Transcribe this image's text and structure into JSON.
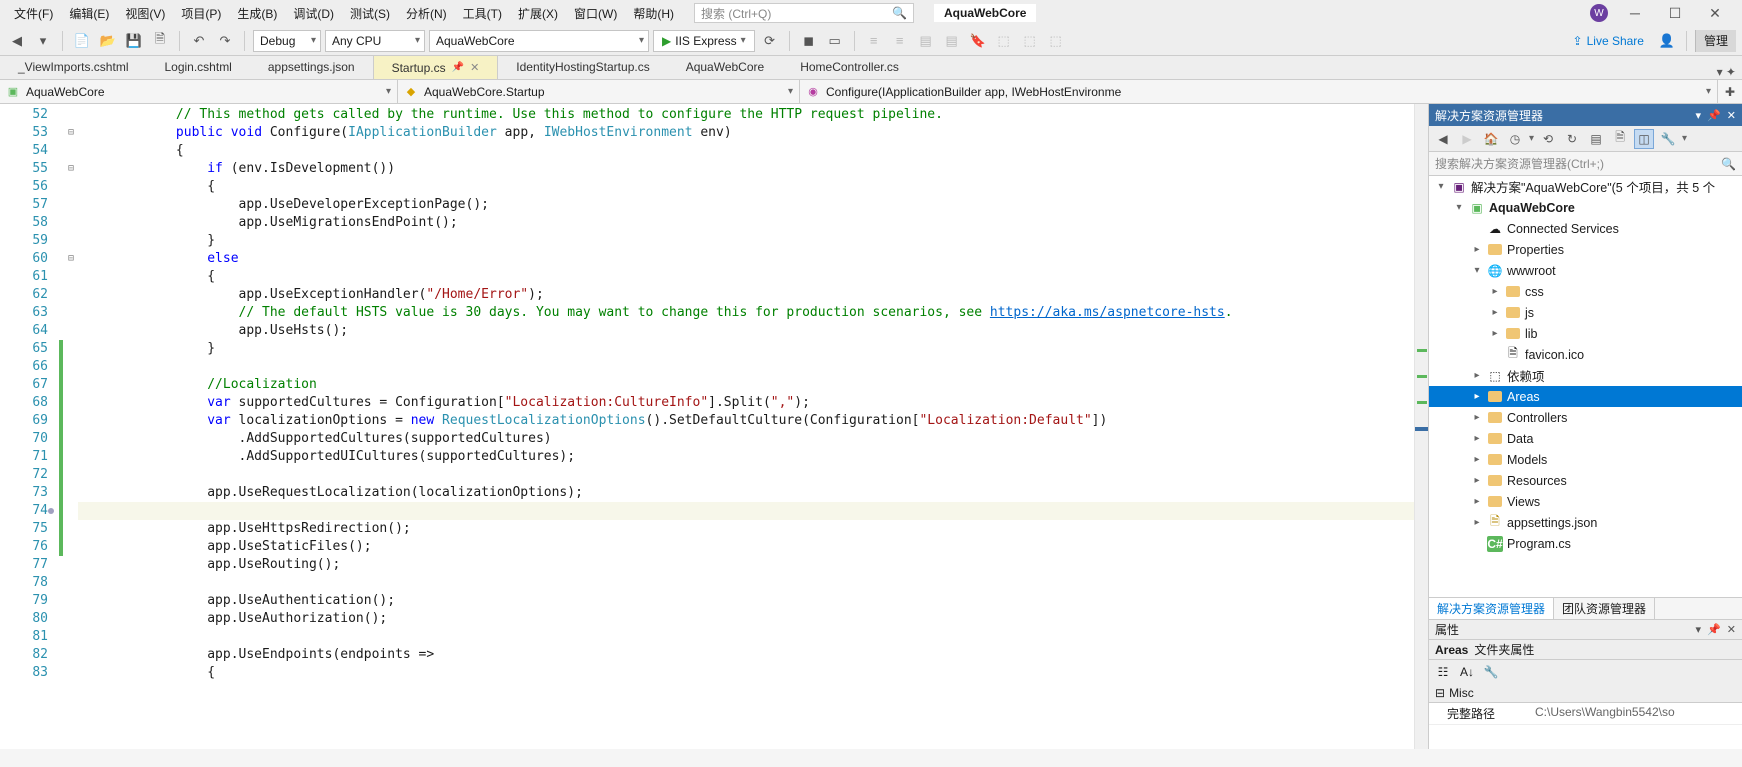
{
  "menu": {
    "items": [
      "文件(F)",
      "编辑(E)",
      "视图(V)",
      "项目(P)",
      "生成(B)",
      "调试(D)",
      "测试(S)",
      "分析(N)",
      "工具(T)",
      "扩展(X)",
      "窗口(W)",
      "帮助(H)"
    ],
    "search_ph": "搜索 (Ctrl+Q)",
    "appname": "AquaWebCore",
    "avatar": "W"
  },
  "toolbar": {
    "config": "Debug",
    "platform": "Any CPU",
    "startup": "AquaWebCore",
    "run": "IIS Express",
    "liveshare": "Live Share",
    "manage": "管理"
  },
  "tabs": {
    "items": [
      {
        "label": "_ViewImports.cshtml",
        "active": false
      },
      {
        "label": "Login.cshtml",
        "active": false
      },
      {
        "label": "appsettings.json",
        "active": false
      },
      {
        "label": "Startup.cs",
        "active": true
      },
      {
        "label": "IdentityHostingStartup.cs",
        "active": false
      },
      {
        "label": "AquaWebCore",
        "active": false
      },
      {
        "label": "HomeController.cs",
        "active": false
      }
    ]
  },
  "nav": {
    "scope": "AquaWebCore",
    "type": "AquaWebCore.Startup",
    "member": "Configure(IApplicationBuilder app, IWebHostEnvironme"
  },
  "code": {
    "first_line": 52,
    "lines": [
      {
        "n": 52,
        "t": "            // This method gets called by the runtime. Use this method to configure the HTTP request pipeline.",
        "cls": "com"
      },
      {
        "n": 53,
        "t": "            public void Configure(IApplicationBuilder app, IWebHostEnvironment env)",
        "parts": [
          [
            "            ",
            ""
          ],
          [
            "public void ",
            "kw"
          ],
          [
            "Configure(",
            ""
          ],
          [
            "IApplicationBuilder",
            "type"
          ],
          [
            " app, ",
            ""
          ],
          [
            "IWebHostEnvironment",
            "type"
          ],
          [
            " env)",
            ""
          ]
        ]
      },
      {
        "n": 54,
        "t": "            {"
      },
      {
        "n": 55,
        "t": "                if (env.IsDevelopment())",
        "parts": [
          [
            "                ",
            ""
          ],
          [
            "if ",
            "kw"
          ],
          [
            "(env.IsDevelopment())",
            ""
          ]
        ]
      },
      {
        "n": 56,
        "t": "                {"
      },
      {
        "n": 57,
        "t": "                    app.UseDeveloperExceptionPage();"
      },
      {
        "n": 58,
        "t": "                    app.UseMigrationsEndPoint();"
      },
      {
        "n": 59,
        "t": "                }"
      },
      {
        "n": 60,
        "t": "                else",
        "parts": [
          [
            "                ",
            ""
          ],
          [
            "else",
            "kw"
          ]
        ]
      },
      {
        "n": 61,
        "t": "                {"
      },
      {
        "n": 62,
        "t": "                    app.UseExceptionHandler(\"/Home/Error\");",
        "parts": [
          [
            "                    app.UseExceptionHandler(",
            ""
          ],
          [
            "\"/Home/Error\"",
            "str"
          ],
          [
            ");",
            ""
          ]
        ]
      },
      {
        "n": 63,
        "t": "                    // The default HSTS value is 30 days. You may want to change this for production scenarios, see https://aka.ms/aspnetcore-hsts.",
        "parts": [
          [
            "                    ",
            ""
          ],
          [
            "// The default HSTS value is 30 days. You may want to change this for production scenarios, see ",
            "com"
          ],
          [
            "https://aka.ms/aspnetcore-hsts",
            "link"
          ],
          [
            ".",
            "com"
          ]
        ]
      },
      {
        "n": 64,
        "t": "                    app.UseHsts();"
      },
      {
        "n": 65,
        "t": "                }",
        "chg": true
      },
      {
        "n": 66,
        "t": "",
        "chg": true
      },
      {
        "n": 67,
        "t": "                //Localization",
        "cls": "com",
        "chg": true
      },
      {
        "n": 68,
        "t": "                var supportedCultures = Configuration[\"Localization:CultureInfo\"].Split(\",\");",
        "chg": true,
        "parts": [
          [
            "                ",
            ""
          ],
          [
            "var ",
            "kw"
          ],
          [
            "supportedCultures = Configuration[",
            ""
          ],
          [
            "\"Localization:CultureInfo\"",
            "str"
          ],
          [
            "].Split(",
            ""
          ],
          [
            "\",\"",
            "str"
          ],
          [
            ");",
            ""
          ]
        ]
      },
      {
        "n": 69,
        "t": "                var localizationOptions = new RequestLocalizationOptions().SetDefaultCulture(Configuration[\"Localization:Default\"])",
        "chg": true,
        "parts": [
          [
            "                ",
            ""
          ],
          [
            "var ",
            "kw"
          ],
          [
            "localizationOptions = ",
            ""
          ],
          [
            "new ",
            "kw"
          ],
          [
            "RequestLocalizationOptions",
            "type"
          ],
          [
            "().SetDefaultCulture(Configuration[",
            ""
          ],
          [
            "\"Localization:Default\"",
            "str"
          ],
          [
            "])",
            ""
          ]
        ]
      },
      {
        "n": 70,
        "t": "                    .AddSupportedCultures(supportedCultures)",
        "chg": true
      },
      {
        "n": 71,
        "t": "                    .AddSupportedUICultures(supportedCultures);",
        "chg": true
      },
      {
        "n": 72,
        "t": "",
        "chg": true
      },
      {
        "n": 73,
        "t": "                app.UseRequestLocalization(localizationOptions);",
        "chg": true
      },
      {
        "n": 74,
        "t": "",
        "chg": true,
        "cur": true
      },
      {
        "n": 75,
        "t": "                app.UseHttpsRedirection();",
        "chg": true
      },
      {
        "n": 76,
        "t": "                app.UseStaticFiles();",
        "chg": true
      },
      {
        "n": 77,
        "t": "                app.UseRouting();"
      },
      {
        "n": 78,
        "t": ""
      },
      {
        "n": 79,
        "t": "                app.UseAuthentication();"
      },
      {
        "n": 80,
        "t": "                app.UseAuthorization();"
      },
      {
        "n": 81,
        "t": ""
      },
      {
        "n": 82,
        "t": "                app.UseEndpoints(endpoints =>"
      },
      {
        "n": 83,
        "t": "                {"
      }
    ],
    "folds": {
      "53": "⊟",
      "55": "⊟",
      "60": "⊟"
    }
  },
  "solution": {
    "header": "解决方案资源管理器",
    "search_ph": "搜索解决方案资源管理器(Ctrl+;)",
    "root": "解决方案\"AquaWebCore\"(5 个项目，共 5 个",
    "tree": [
      {
        "d": 0,
        "exp": "▾",
        "icon": "sln",
        "label": "解决方案\"AquaWebCore\"(5 个项目，共 5 个",
        "bold": false
      },
      {
        "d": 1,
        "exp": "▾",
        "icon": "proj",
        "label": "AquaWebCore",
        "bold": true
      },
      {
        "d": 2,
        "exp": "",
        "icon": "cloud",
        "label": "Connected Services"
      },
      {
        "d": 2,
        "exp": "▸",
        "icon": "fold",
        "label": "Properties"
      },
      {
        "d": 2,
        "exp": "▾",
        "icon": "globe",
        "label": "wwwroot"
      },
      {
        "d": 3,
        "exp": "▸",
        "icon": "fold",
        "label": "css"
      },
      {
        "d": 3,
        "exp": "▸",
        "icon": "fold",
        "label": "js"
      },
      {
        "d": 3,
        "exp": "▸",
        "icon": "fold",
        "label": "lib"
      },
      {
        "d": 3,
        "exp": "",
        "icon": "file",
        "label": "favicon.ico"
      },
      {
        "d": 2,
        "exp": "▸",
        "icon": "dep",
        "label": "依赖项"
      },
      {
        "d": 2,
        "exp": "▸",
        "icon": "fold",
        "label": "Areas",
        "sel": true
      },
      {
        "d": 2,
        "exp": "▸",
        "icon": "fold",
        "label": "Controllers"
      },
      {
        "d": 2,
        "exp": "▸",
        "icon": "fold",
        "label": "Data"
      },
      {
        "d": 2,
        "exp": "▸",
        "icon": "fold",
        "label": "Models"
      },
      {
        "d": 2,
        "exp": "▸",
        "icon": "fold",
        "label": "Resources"
      },
      {
        "d": 2,
        "exp": "▸",
        "icon": "fold",
        "label": "Views"
      },
      {
        "d": 2,
        "exp": "▸",
        "icon": "json",
        "label": "appsettings.json"
      },
      {
        "d": 2,
        "exp": "",
        "icon": "cs",
        "label": "Program.cs"
      }
    ],
    "tabs": [
      "解决方案资源管理器",
      "团队资源管理器"
    ]
  },
  "props": {
    "header": "属性",
    "title_name": "Areas",
    "title_type": "文件夹属性",
    "cat": "Misc",
    "rows": [
      {
        "k": "完整路径",
        "v": "C:\\Users\\Wangbin5542\\so"
      }
    ]
  }
}
